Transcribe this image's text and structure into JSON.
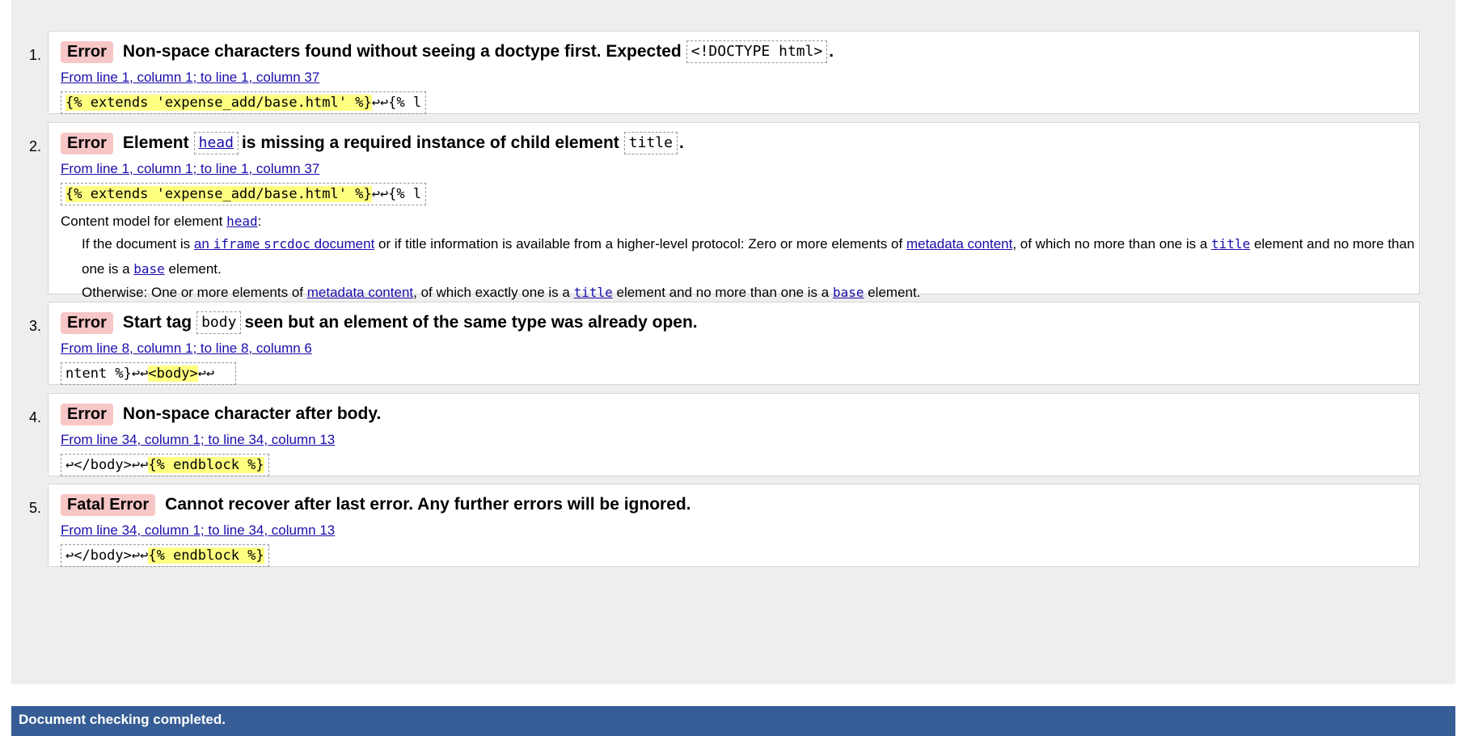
{
  "messages": [
    {
      "num": "1.",
      "badge": "Error",
      "pre": "Non-space characters found without seeing a doctype first. Expected",
      "code": "<!DOCTYPE html>",
      "post": ".",
      "location": "From line 1, column 1; to line 1, column 37",
      "extract_hl": "{% extends 'expense_add/base.html' %}",
      "extract_rest": "↩↩{% l"
    },
    {
      "num": "2.",
      "badge": "Error",
      "pre": "Element",
      "code": "head",
      "mid": "is missing a required instance of child element",
      "code2": "title",
      "post": ".",
      "location": "From line 1, column 1; to line 1, column 37",
      "extract_hl": "{% extends 'expense_add/base.html' %}",
      "extract_rest": "↩↩{% l",
      "content_model": {
        "label": "Content model for element",
        "element": "head",
        "colon": ":",
        "item1": {
          "t1": "If the document is",
          "link1a": "an",
          "link1b": "iframe",
          "link1c": "srcdoc",
          "link1d": "document",
          "t2": "or if title information is available from a higher-level protocol: Zero or more elements of",
          "link2": "metadata content",
          "t3": ", of which no more than one is a",
          "link3": "title",
          "t4": "element and no more than one is a",
          "link4": "base",
          "t5": "element."
        },
        "item2": {
          "t1": "Otherwise: One or more elements of",
          "link1": "metadata content",
          "t2": ", of which exactly one is a",
          "link2": "title",
          "t3": "element and no more than one is a",
          "link3": "base",
          "t4": "element."
        }
      }
    },
    {
      "num": "3.",
      "badge": "Error",
      "pre": "Start tag",
      "code": "body",
      "post": "seen but an element of the same type was already open.",
      "location": "From line 8, column 1; to line 8, column 6",
      "extract_pre": "ntent %}↩↩",
      "extract_hl": "<body>",
      "extract_rest": "↩↩  "
    },
    {
      "num": "4.",
      "badge": "Error",
      "pre": "Non-space character after body.",
      "location": "From line 34, column 1; to line 34, column 13",
      "extract_pre": "↩</body>↩↩",
      "extract_hl": "{% endblock %}"
    },
    {
      "num": "5.",
      "badge": "Fatal Error",
      "pre": "Cannot recover after last error. Any further errors will be ignored.",
      "location": "From line 34, column 1; to line 34, column 13",
      "extract_pre": "↩</body>↩↩",
      "extract_hl": "{% endblock %}"
    }
  ],
  "status": {
    "text": "Document checking completed."
  },
  "colors": {
    "panel_bg": "#eeeeee",
    "badge_bg": "#f7c6c6",
    "highlight": "#ffff80",
    "link": "#1a0dab",
    "status_bar": "#365d95"
  }
}
